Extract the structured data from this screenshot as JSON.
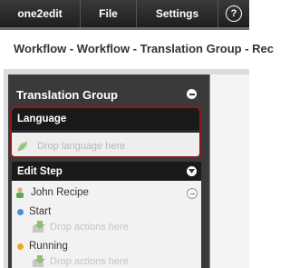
{
  "menu": {
    "app": "one2edit",
    "file": "File",
    "settings": "Settings",
    "help_glyph": "?"
  },
  "breadcrumb": "Workflow - Workflow - Translation Group - Rec",
  "panel": {
    "title": "Translation Group",
    "language": {
      "header": "Language",
      "drop_placeholder": "Drop language here"
    },
    "edit_step": {
      "header": "Edit Step",
      "user": "John Recipe",
      "steps": [
        {
          "label": "Start",
          "color": "#4a90d9",
          "drop_placeholder": "Drop actions here"
        },
        {
          "label": "Running",
          "color": "#e8a820",
          "drop_placeholder": "Drop actions here"
        }
      ]
    }
  },
  "colors": {
    "highlight_border": "#8c1c1c",
    "panel_bg": "#3a3a3a"
  }
}
